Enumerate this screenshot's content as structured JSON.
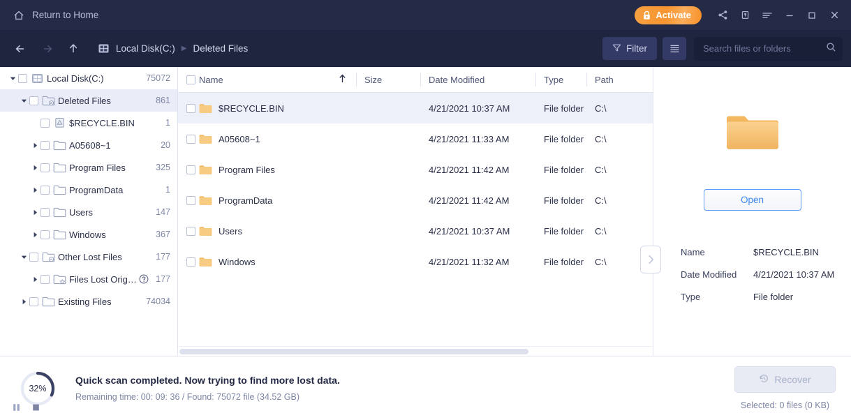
{
  "titlebar": {
    "home_label": "Return to Home",
    "activate_label": "Activate",
    "icons": [
      "home-icon",
      "lock-icon",
      "share-icon",
      "feedback-icon",
      "menu-icon",
      "minimize-icon",
      "maximize-icon",
      "close-icon"
    ]
  },
  "toolbar": {
    "back_icon": "arrow-left-icon",
    "forward_icon": "arrow-right-icon",
    "up_icon": "arrow-up-icon",
    "breadcrumb": [
      "Local Disk(C:)",
      "Deleted Files"
    ],
    "filter_label": "Filter",
    "view_icon": "list-view-icon",
    "search_placeholder": "Search files or folders",
    "search_value": ""
  },
  "sidebar": {
    "items": [
      {
        "label": "Local Disk(C:)",
        "count": "75072",
        "depth": 0,
        "icon": "disk-icon",
        "twisty": "down",
        "selected": false
      },
      {
        "label": "Deleted Files",
        "count": "861",
        "depth": 1,
        "icon": "deleted-folder-icon",
        "twisty": "down",
        "selected": true
      },
      {
        "label": "$RECYCLE.BIN",
        "count": "1",
        "depth": 2,
        "icon": "recycle-bin-icon",
        "twisty": "none",
        "selected": false
      },
      {
        "label": "A05608~1",
        "count": "20",
        "depth": 2,
        "icon": "folder-icon",
        "twisty": "right",
        "selected": false
      },
      {
        "label": "Program Files",
        "count": "325",
        "depth": 2,
        "icon": "folder-icon",
        "twisty": "right",
        "selected": false
      },
      {
        "label": "ProgramData",
        "count": "1",
        "depth": 2,
        "icon": "folder-icon",
        "twisty": "right",
        "selected": false
      },
      {
        "label": "Users",
        "count": "147",
        "depth": 2,
        "icon": "folder-icon",
        "twisty": "right",
        "selected": false
      },
      {
        "label": "Windows",
        "count": "367",
        "depth": 2,
        "icon": "folder-icon",
        "twisty": "right",
        "selected": false
      },
      {
        "label": "Other Lost Files",
        "count": "177",
        "depth": 1,
        "icon": "lost-folder-icon",
        "twisty": "down",
        "selected": false
      },
      {
        "label": "Files Lost Original ...",
        "count": "177",
        "depth": 2,
        "icon": "star-folder-icon",
        "twisty": "right",
        "selected": false,
        "help": true
      },
      {
        "label": "Existing Files",
        "count": "74034",
        "depth": 1,
        "icon": "folder-icon",
        "twisty": "right",
        "selected": false
      }
    ]
  },
  "filelist": {
    "columns": [
      "Name",
      "Size",
      "Date Modified",
      "Type",
      "Path"
    ],
    "sort_icon": "sort-ascending-icon",
    "rows": [
      {
        "name": "$RECYCLE.BIN",
        "size": "",
        "date": "4/21/2021 10:37 AM",
        "type": "File folder",
        "path": "C:\\",
        "selected": true
      },
      {
        "name": "A05608~1",
        "size": "",
        "date": "4/21/2021 11:33 AM",
        "type": "File folder",
        "path": "C:\\",
        "selected": false
      },
      {
        "name": "Program Files",
        "size": "",
        "date": "4/21/2021 11:42 AM",
        "type": "File folder",
        "path": "C:\\",
        "selected": false
      },
      {
        "name": "ProgramData",
        "size": "",
        "date": "4/21/2021 11:42 AM",
        "type": "File folder",
        "path": "C:\\",
        "selected": false
      },
      {
        "name": "Users",
        "size": "",
        "date": "4/21/2021 10:37 AM",
        "type": "File folder",
        "path": "C:\\",
        "selected": false
      },
      {
        "name": "Windows",
        "size": "",
        "date": "4/21/2021 11:32 AM",
        "type": "File folder",
        "path": "C:\\",
        "selected": false
      }
    ]
  },
  "preview": {
    "thumbnail_icon": "folder-icon-large",
    "open_label": "Open",
    "collapse_icon": "chevron-right-icon",
    "properties": [
      {
        "key": "Name",
        "value": "$RECYCLE.BIN"
      },
      {
        "key": "Date Modified",
        "value": "4/21/2021 10:37 AM"
      },
      {
        "key": "Type",
        "value": "File folder"
      }
    ]
  },
  "statusbar": {
    "progress_percent": "32%",
    "progress_value": 32,
    "pause_icon": "pause-icon",
    "stop_icon": "stop-icon",
    "main_text": "Quick scan completed. Now trying to find more lost data.",
    "sub_text": "Remaining time: 00: 09: 36 / Found: 75072 file (34.52 GB)",
    "recover_label": "Recover",
    "recover_icon": "recover-clock-icon",
    "selected_info": "Selected: 0 files (0 KB)"
  },
  "colors": {
    "titlebar_bg": "#252a47",
    "toolbar_bg": "#20253f",
    "accent_orange": "#f79530",
    "accent_blue": "#3b87ef",
    "row_selected": "#eef0f9",
    "tree_selected": "#eaedf8",
    "folder_yellow": "#f7c16b"
  }
}
